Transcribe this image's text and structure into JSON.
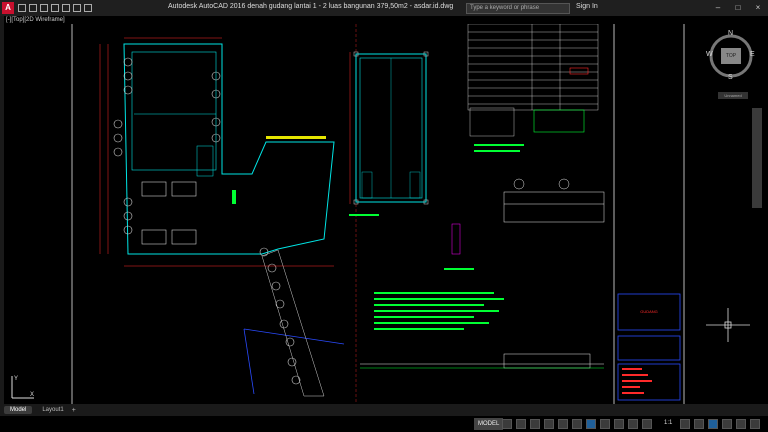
{
  "window": {
    "app_logo": "A",
    "title": "Autodesk AutoCAD 2016     denah gudang lantai 1 - 2 luas bangunan 379,50m2 - asdar.id.dwg",
    "search_placeholder": "Type a keyword or phrase",
    "signin": "Sign In",
    "minimize": "–",
    "maximize": "□",
    "close": "×"
  },
  "viewport": {
    "label": "[-][Top][2D Wireframe]"
  },
  "viewcube": {
    "face": "TOP",
    "north": "N",
    "south": "S",
    "east": "E",
    "west": "W",
    "ucs_label": "Unnamed"
  },
  "drawing": {
    "title_block_label": "GUDANG",
    "colors": {
      "walls": "#00e5e5",
      "dims": "#ff2a2a",
      "text": "#00ff33",
      "frame": "#e8e8e8",
      "vegetation": "#cfcfcf",
      "blue": "#2a4bff",
      "yellow": "#e6e600",
      "magenta": "#ff00ff"
    }
  },
  "tabs": {
    "model": "Model",
    "layout1": "Layout1",
    "add": "+"
  },
  "status": {
    "model": "MODEL",
    "scale": "1:1"
  }
}
